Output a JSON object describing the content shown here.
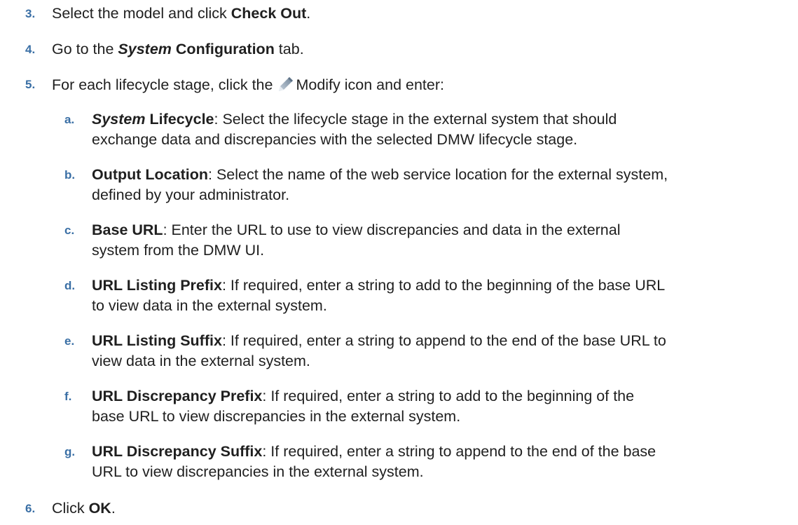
{
  "steps": {
    "s3": {
      "number": "3.",
      "before": "Select the model and click ",
      "bold": "Check Out",
      "after": "."
    },
    "s4": {
      "number": "4.",
      "before": "Go to the ",
      "bold_italic": "System",
      "space": " ",
      "bold": "Configuration",
      "after": " tab."
    },
    "s5": {
      "number": "5.",
      "before": "For each lifecycle stage, click the ",
      "icon": "pencil-icon",
      "after": "Modify icon and enter:"
    },
    "s6": {
      "number": "6.",
      "before": "Click ",
      "bold": "OK",
      "after": "."
    }
  },
  "substeps": {
    "a": {
      "letter": "a.",
      "bold_italic": "System",
      "space": " ",
      "bold": "Lifecycle",
      "line1": ": Select the lifecycle stage in the external system that should",
      "line2": "exchange data and discrepancies with the selected DMW lifecycle stage."
    },
    "b": {
      "letter": "b.",
      "bold": "Output Location",
      "line1": ": Select the name of the web service location for the external system,",
      "line2": "defined by your administrator."
    },
    "c": {
      "letter": "c.",
      "bold": "Base URL",
      "line1": ": Enter the URL to use to view discrepancies and data in the external",
      "line2": "system from the DMW UI."
    },
    "d": {
      "letter": "d.",
      "bold": "URL Listing Prefix",
      "line1": ": If required, enter a string to add to the beginning of the base URL",
      "line2": "to view data in the external system."
    },
    "e": {
      "letter": "e.",
      "bold": "URL Listing Suffix",
      "line1": ": If required, enter a string to append to the end of the base URL to",
      "line2": "view data in the external system."
    },
    "f": {
      "letter": "f.",
      "bold": "URL Discrepancy Prefix",
      "line1": ": If required, enter a string to add to the beginning of the",
      "line2": "base URL to view discrepancies in the external system."
    },
    "g": {
      "letter": "g.",
      "bold": "URL Discrepancy Suffix",
      "line1": ": If required, enter a string to append to the end of the base",
      "line2": "URL to view discrepancies in the external system."
    }
  },
  "colors": {
    "number": "#3a6fa5",
    "text": "#1f1f1f",
    "icon_pencil": "#7b8fa3"
  }
}
